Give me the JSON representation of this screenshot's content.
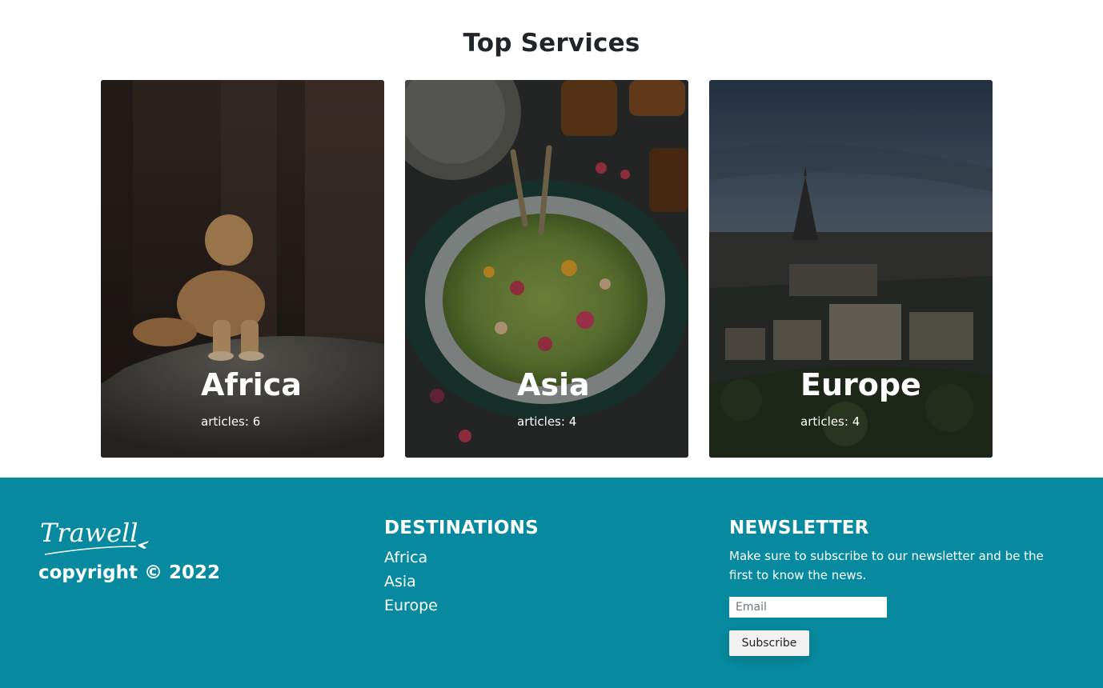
{
  "section": {
    "title": "Top Services"
  },
  "cards": [
    {
      "name": "Africa",
      "articles": "articles: 6"
    },
    {
      "name": "Asia",
      "articles": "articles: 4"
    },
    {
      "name": "Europe",
      "articles": "articles: 4"
    }
  ],
  "footer": {
    "logo_text": "Trawell",
    "copyright": "copyright © 2022",
    "destinations": {
      "title": "DESTINATIONS",
      "links": [
        "Africa",
        "Asia",
        "Europe"
      ]
    },
    "newsletter": {
      "title": "NEWSLETTER",
      "text": "Make sure to subscribe to our newsletter and be the first to know the news.",
      "email_placeholder": "Email",
      "email_value": "",
      "subscribe_label": "Subscribe"
    }
  },
  "colors": {
    "footer_bg": "#078aa0",
    "text_dark": "#212529",
    "white": "#ffffff"
  }
}
